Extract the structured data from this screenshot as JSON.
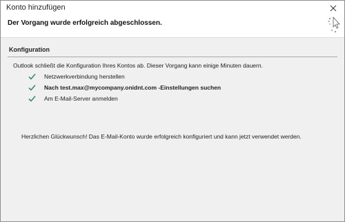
{
  "window": {
    "title": "Konto hinzufügen",
    "close_icon": "close-icon"
  },
  "header": {
    "headline": "Der Vorgang wurde erfolgreich abgeschlossen.",
    "status_icon": "wait-cursor-icon"
  },
  "section": {
    "title": "Konfiguration",
    "intro": "Outlook schließt die Konfiguration Ihres Kontos ab. Dieser Vorgang kann einige Minuten dauern.",
    "steps": [
      {
        "label": "Netzwerkverbindung herstellen",
        "status": "done",
        "icon": "checkmark-icon"
      },
      {
        "label": "Nach  test.max@mycompany.onidnt.com -Einstellungen suchen",
        "status": "done",
        "icon": "checkmark-icon"
      },
      {
        "label": "Am E-Mail-Server anmelden",
        "status": "done",
        "icon": "checkmark-icon"
      }
    ],
    "congrats": "Herzlichen Glückwunsch! Das E-Mail-Konto wurde erfolgreich konfiguriert und kann jetzt verwendet werden."
  },
  "colors": {
    "check": "#3c8a5a",
    "background": "#f0f0f0",
    "divider": "#a8a8a8"
  }
}
